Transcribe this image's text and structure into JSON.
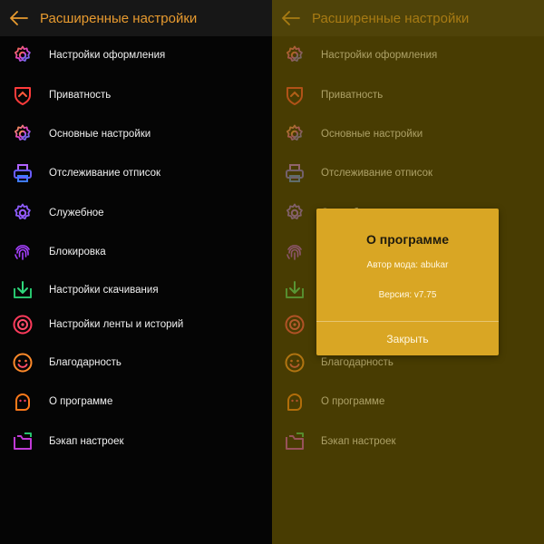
{
  "header": {
    "title": "Расширенные настройки",
    "back_icon": "arrow-left-icon",
    "title_color": "#e79a2f"
  },
  "menu": {
    "items": [
      {
        "label": "Настройки оформления",
        "icon": "gear-icon"
      },
      {
        "label": "Приватность",
        "icon": "shield-icon"
      },
      {
        "label": "Основные настройки",
        "icon": "gear-icon"
      },
      {
        "label": "Отслеживание отписок",
        "icon": "printer-icon"
      },
      {
        "label": "Служебное",
        "icon": "gear-icon"
      },
      {
        "label": "Блокировка",
        "icon": "fingerprint-icon"
      },
      {
        "label": "Настройки скачивания",
        "icon": "download-icon"
      },
      {
        "label": "Настройки ленты и историй",
        "icon": "target-icon"
      },
      {
        "label": "Благодарность",
        "icon": "smile-icon"
      },
      {
        "label": "О программе",
        "icon": "ghost-icon"
      },
      {
        "label": "Бэкап настроек",
        "icon": "folder-icon"
      }
    ]
  },
  "dialog": {
    "title": "О программе",
    "author": "Автор мода: abukar",
    "version": "Версия: v7.75",
    "close_label": "Закрыть",
    "background": "#d9a624"
  },
  "colors": {
    "background": "#050505",
    "appbar": "#171717",
    "scrim": "#786400",
    "text": "#f0f0f0"
  }
}
